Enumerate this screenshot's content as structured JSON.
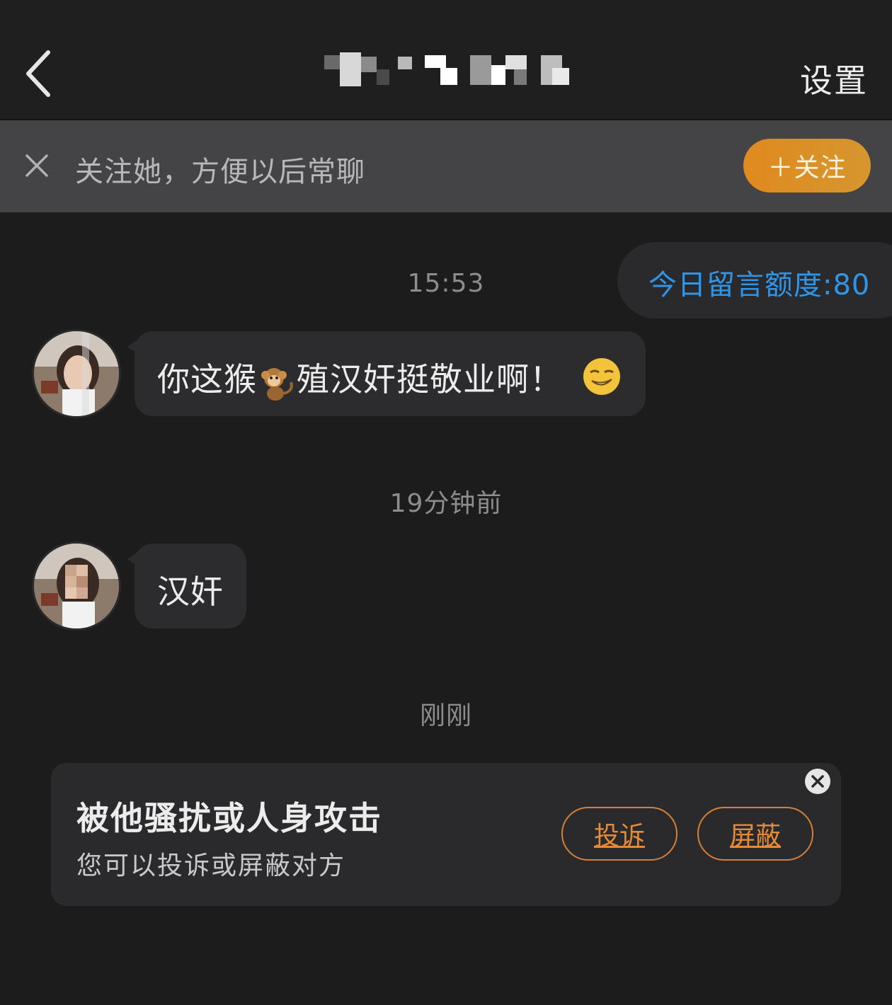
{
  "header": {
    "title": "",
    "settings_label": "设置"
  },
  "follow_banner": {
    "text": "关注她，方便以后常聊",
    "button_label": "＋关注"
  },
  "quota": {
    "text": "今日留言额度:80"
  },
  "messages": [
    {
      "timestamp": "15:53",
      "text_before": "你这猴",
      "inline_icon": "monkey-emoji",
      "text_after": "殖汉奸挺敬业啊！",
      "trailing_icon": "smirk-emoji"
    },
    {
      "timestamp": "19分钟前",
      "text": "汉奸"
    }
  ],
  "latest_timestamp": "刚刚",
  "report_card": {
    "title": "被他骚扰或人身攻击",
    "subtitle": "您可以投诉或屏蔽对方",
    "report_label": "投诉",
    "block_label": "屏蔽"
  },
  "colors": {
    "accent_orange": "#e08a1e",
    "link_blue": "#2f95e8",
    "background": "#1c1c1d"
  }
}
